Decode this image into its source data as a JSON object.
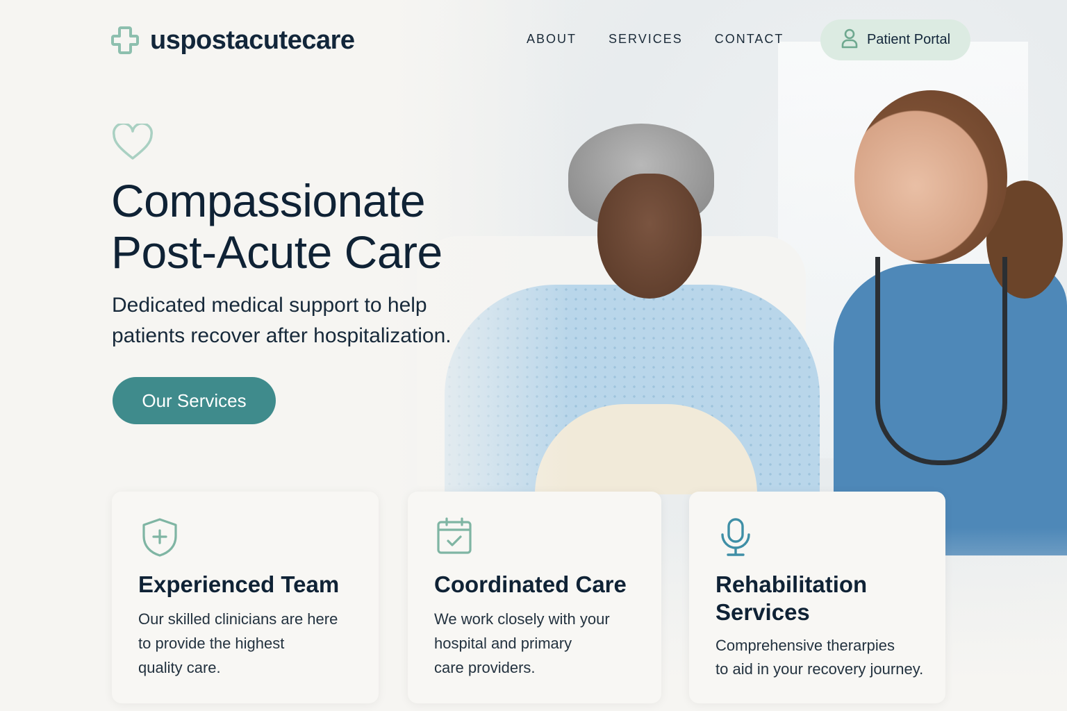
{
  "brand": {
    "name": "uspostacutecare",
    "logo_icon": "medical-cross-icon",
    "accent": "#3f8b8c",
    "icon_color": "#8dbfae",
    "title_color": "#0f2235"
  },
  "nav": {
    "items": [
      {
        "label": "ABOUT"
      },
      {
        "label": "SERVICES"
      },
      {
        "label": "CONTACT"
      }
    ],
    "portal_button": {
      "label": "Patient Portal",
      "icon": "user-icon",
      "background": "#dcebe2"
    }
  },
  "hero": {
    "icon": "heart-icon",
    "title_lines": [
      "Compassionate",
      "Post-Acute Care"
    ],
    "subtitle_lines": [
      "Dedicated medical support to help",
      "patients recover after hospitalization."
    ],
    "cta": {
      "label": "Our Services"
    }
  },
  "features": [
    {
      "icon": "shield-plus-icon",
      "title_lines": [
        "Experienced Team"
      ],
      "text_lines": [
        "Our skilled clinicians are here",
        "to provide the highest",
        "quality care."
      ]
    },
    {
      "icon": "calendar-check-icon",
      "title_lines": [
        "Coordinated Care"
      ],
      "text_lines": [
        "We work closely with your",
        "hospital and primary",
        "care providers."
      ]
    },
    {
      "icon": "microphone-icon",
      "title_lines": [
        "Rehabilitation",
        "Services"
      ],
      "text_lines": [
        "Comprehensive therarpies",
        "to aid in your recovery journey."
      ]
    }
  ]
}
